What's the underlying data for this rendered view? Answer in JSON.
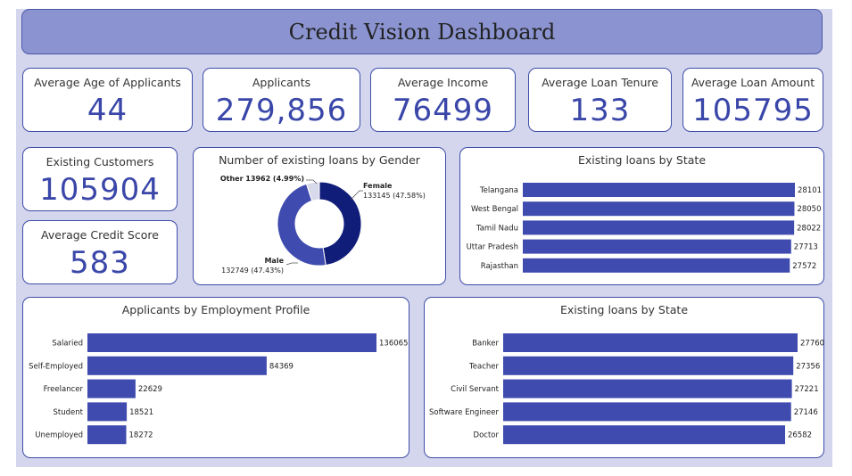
{
  "header": {
    "title": "Credit Vision Dashboard"
  },
  "colors": {
    "bar": "#3f4bae",
    "accent": "#3a47a9",
    "female": "#101e7a",
    "male": "#3f4bae",
    "other": "#d8daec"
  },
  "kpis": [
    {
      "label": "Average Age of Applicants",
      "value": "44"
    },
    {
      "label": "Applicants",
      "value": "279,856"
    },
    {
      "label": "Average Income",
      "value": "76499"
    },
    {
      "label": "Average Loan Tenure",
      "value": "133"
    },
    {
      "label": "Average Loan Amount",
      "value": "105795"
    },
    {
      "label": "Existing Customers",
      "value": "105904"
    },
    {
      "label": "Average Credit Score",
      "value": "583"
    }
  ],
  "chart_data": [
    {
      "type": "pie",
      "title": "Number of existing loans by Gender",
      "categories": [
        "Female",
        "Male",
        "Other"
      ],
      "values": [
        133145,
        132749,
        13962
      ],
      "labels": [
        "133145 (47.58%)",
        "132749 (47.43%)",
        "Other 13962 (4.99%)"
      ]
    },
    {
      "type": "bar",
      "title": "Existing loans by State",
      "categories": [
        "Telangana",
        "West Bengal",
        "Tamil Nadu",
        "Uttar Pradesh",
        "Rajasthan"
      ],
      "values": [
        28101,
        28050,
        28022,
        27713,
        27572
      ]
    },
    {
      "type": "bar",
      "title": "Applicants by Employment Profile",
      "categories": [
        "Salaried",
        "Self-Employed",
        "Freelancer",
        "Student",
        "Unemployed"
      ],
      "values": [
        136065,
        84369,
        22629,
        18521,
        18272
      ]
    },
    {
      "type": "bar",
      "title": "Existing loans by State",
      "categories": [
        "Banker",
        "Teacher",
        "Civil Servant",
        "Software Engineer",
        "Doctor"
      ],
      "values": [
        27760,
        27356,
        27221,
        27146,
        26582
      ]
    }
  ]
}
